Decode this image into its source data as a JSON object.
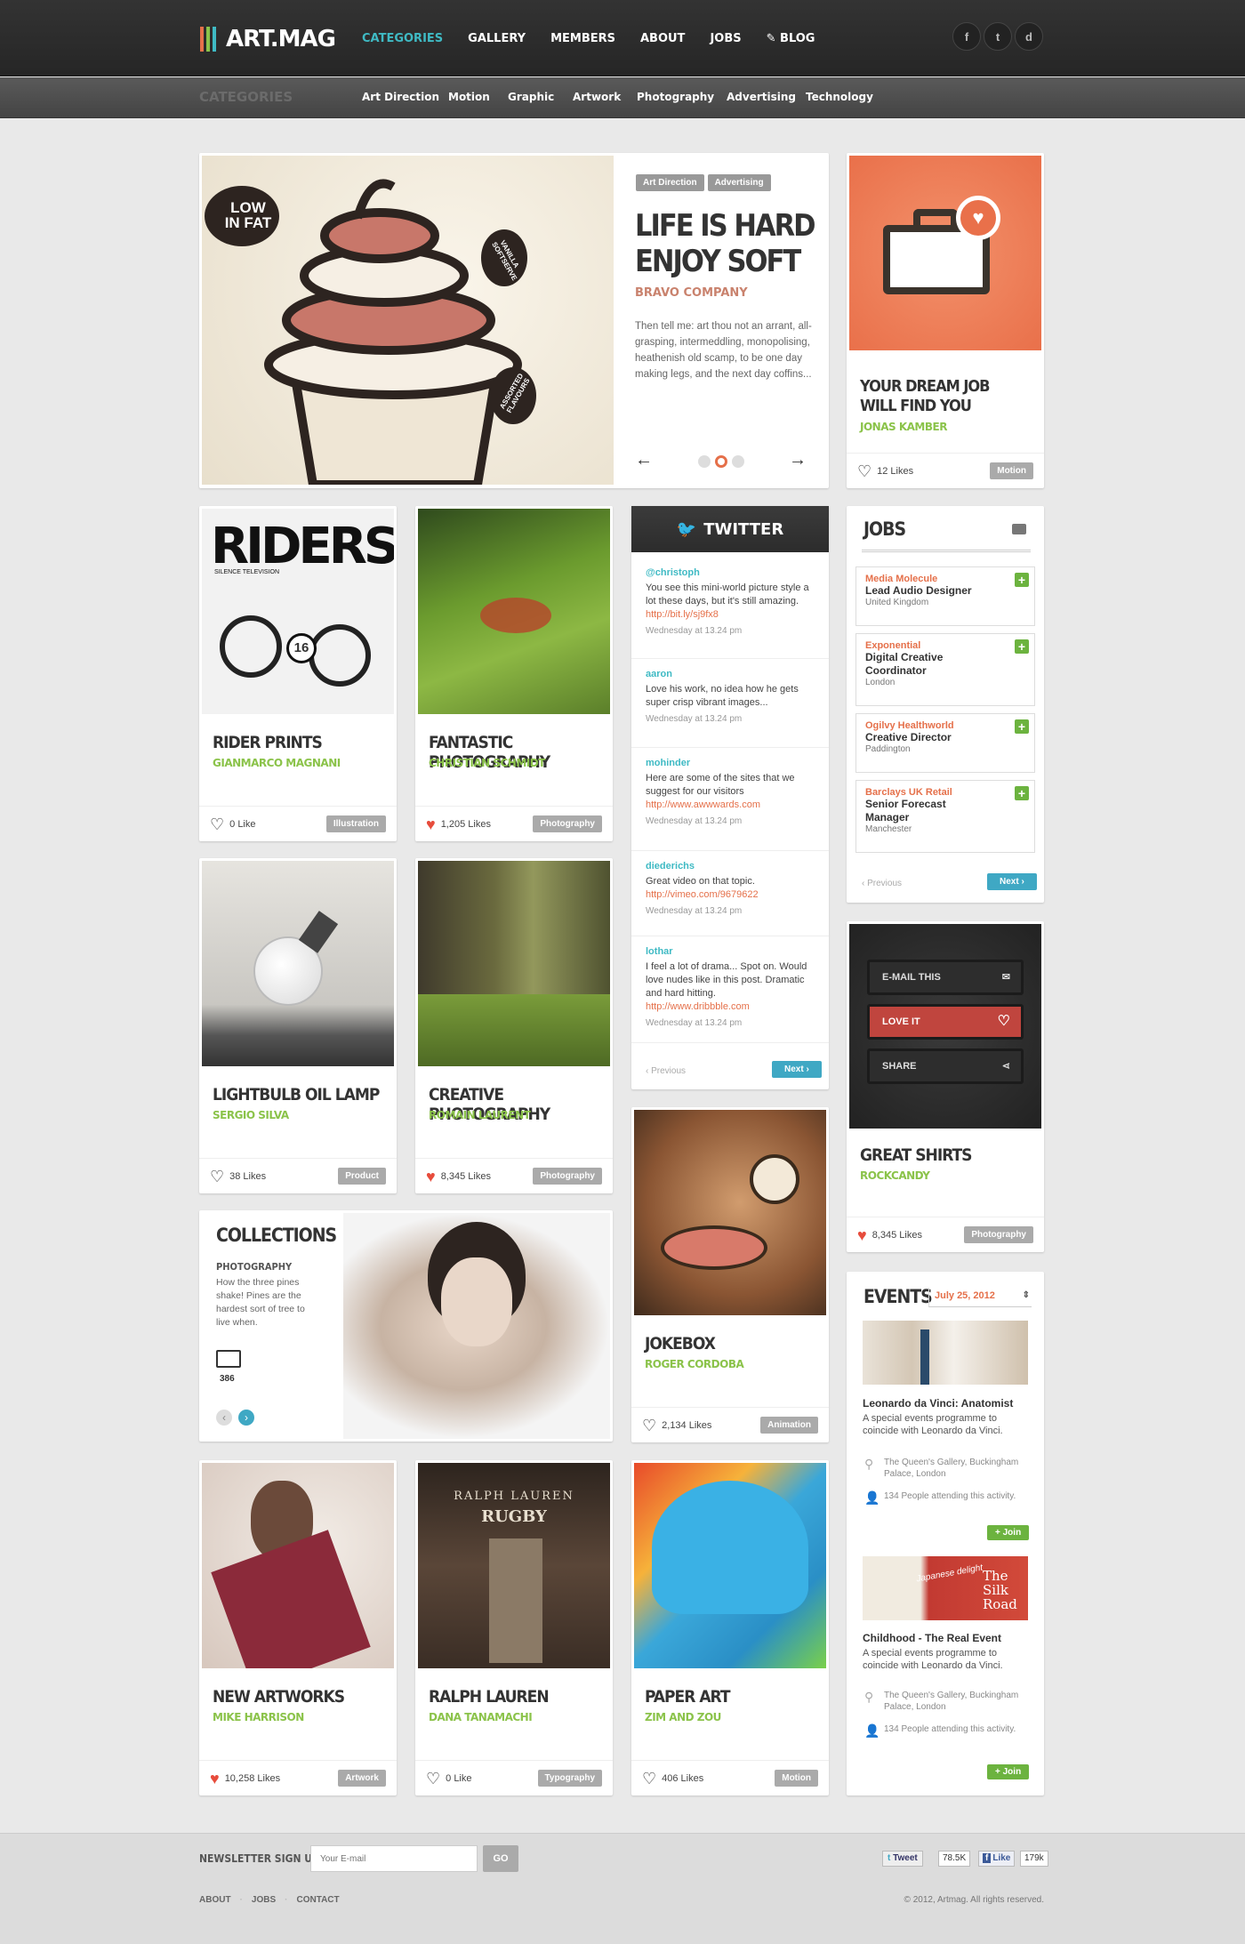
{
  "brand": {
    "name": "ART.MAG",
    "bar_colors": [
      "#e5704a",
      "#8bc34a",
      "#3fbac4"
    ]
  },
  "nav": {
    "items": [
      "CATEGORIES",
      "GALLERY",
      "MEMBERS",
      "ABOUT",
      "JOBS",
      "BLOG"
    ],
    "active": "CATEGORIES"
  },
  "social": {
    "facebook": "f",
    "twitter": "t",
    "dribbble": "d"
  },
  "subnav": {
    "title": "CATEGORIES",
    "items": [
      "Art Direction",
      "Motion",
      "Graphic",
      "Artwork",
      "Photography",
      "Advertising",
      "Technology"
    ]
  },
  "featured": {
    "tags": [
      "Art Direction",
      "Advertising"
    ],
    "title_line1": "LIFE IS HARD",
    "title_line2": "ENJOY SOFT",
    "author": "BRAVO COMPANY",
    "body": "Then tell me: art thou not an arrant, all-grasping, intermeddling, monopolising, heathenish old scamp, to be one day making legs, and the next day coffins...",
    "sticker_low": "LOW IN FAT",
    "sticker_vanilla": "VANILLA SOFTSERVE",
    "sticker_assorted": "ASSORTED FLAVOURS",
    "prev_arrow": "←",
    "next_arrow": "→"
  },
  "job_card": {
    "title": "YOUR DREAM JOB WILL FIND YOU",
    "author": "JONAS KAMBER",
    "likes": "12 Likes",
    "tag": "Motion"
  },
  "cards": [
    {
      "title": "RIDER PRINTS",
      "author": "GIANMARCO MAGNANI",
      "likes": "0 Like",
      "tag": "Illustration",
      "cover_title": "RIDERS",
      "cover_sub": "SILENCE TELEVISION",
      "bike_number": "16"
    },
    {
      "title": "FANTASTIC PHOTOGRAPHY",
      "author": "CHRISTIAN SCHMIDT",
      "likes": "1,205 Likes",
      "tag": "Photography"
    },
    {
      "title": "LIGHTBULB OIL LAMP",
      "author": "SERGIO SILVA",
      "likes": "38 Likes",
      "tag": "Product"
    },
    {
      "title": "CREATIVE PHOTOGRAPHY",
      "author": "ROMAIN LAURENT",
      "likes": "8,345 Likes",
      "tag": "Photography"
    },
    {
      "title": "JOKEBOX",
      "author": "ROGER CORDOBA",
      "likes": "2,134 Likes",
      "tag": "Animation"
    },
    {
      "title": "NEW ARTWORKS",
      "author": "MIKE HARRISON",
      "likes": "10,258 Likes",
      "tag": "Artwork"
    },
    {
      "title": "RALPH LAUREN",
      "author": "DANA TANAMACHI",
      "likes": "0 Like",
      "tag": "Typography",
      "sign_line1": "RALPH LAUREN",
      "sign_line2": "RUGBY"
    },
    {
      "title": "PAPER ART",
      "author": "ZIM AND ZOU",
      "likes": "406 Likes",
      "tag": "Motion"
    }
  ],
  "twitter": {
    "title": "TWITTER",
    "tweets": [
      {
        "user": "@christoph",
        "text": "You see this mini-world picture style a lot these days, but it's still amazing.",
        "link": "http://bit.ly/sj9fx8",
        "time": "Wednesday at 13.24 pm"
      },
      {
        "user": "aaron",
        "text": "Love his work, no idea how he gets super crisp vibrant images...",
        "link": "",
        "time": "Wednesday at 13.24 pm"
      },
      {
        "user": "mohinder",
        "text": "Here are some of the sites that we suggest for our visitors",
        "link": "http://www.awwwards.com",
        "time": "Wednesday at 13.24 pm"
      },
      {
        "user": "diederichs",
        "text": "Great video on that topic.",
        "link": "http://vimeo.com/9679622",
        "time": "Wednesday at 13.24 pm"
      },
      {
        "user": "lothar",
        "text": "I feel a lot of drama... Spot on. Would love nudes like in this post. Dramatic and hard hitting.",
        "link": "http://www.dribbble.com",
        "time": "Wednesday at 13.24 pm"
      }
    ],
    "prev": "‹  Previous",
    "next": "Next  ›"
  },
  "jobs": {
    "title": "JOBS",
    "items": [
      {
        "company": "Media Molecule",
        "role": "Lead Audio Designer",
        "location": "United Kingdom"
      },
      {
        "company": "Exponential",
        "role": "Digital Creative Coordinator",
        "location": "London"
      },
      {
        "company": "Ogilvy Healthworld",
        "role": "Creative Director",
        "location": "Paddington"
      },
      {
        "company": "Barclays UK Retail",
        "role": "Senior Forecast Manager",
        "location": "Manchester"
      }
    ],
    "prev": "‹  Previous",
    "next": "Next  ›"
  },
  "shirts": {
    "actions": [
      "E-MAIL THIS",
      "LOVE IT",
      "SHARE"
    ],
    "title": "GREAT SHIRTS",
    "author": "ROCKCANDY",
    "likes": "8,345 Likes",
    "tag": "Photography"
  },
  "collections": {
    "title": "COLLECTIONS",
    "subtitle": "PHOTOGRAPHY",
    "body": "How the three pines shake! Pines are the hardest sort of tree to live when.",
    "count": "386"
  },
  "events": {
    "title": "EVENTS",
    "date": "July 25, 2012",
    "items": [
      {
        "title": "Leonardo da Vinci: Anatomist",
        "desc": "A special events programme to coincide with Leonardo da Vinci.",
        "place": "The Queen's Gallery, Buckingham Palace, London",
        "attending": "134 People attending this activity.",
        "join": "+ Join"
      },
      {
        "title": "Childhood - The Real Event",
        "desc": "A special events programme to coincide with Leonardo da Vinci.",
        "place": "The Queen's Gallery, Buckingham Palace, London",
        "attending": "134 People attending this activity.",
        "join": "+ Join",
        "image_line1": "Japanese delight",
        "image_line2": "The Silk Road"
      }
    ]
  },
  "footer": {
    "newsletter": "NEWSLETTER SIGN UP",
    "email_placeholder": "Your E-mail",
    "go": "GO",
    "tweet": "Tweet",
    "tweet_count": "78.5K",
    "like": "Like",
    "like_count": "179k",
    "links": [
      "ABOUT",
      "JOBS",
      "CONTACT"
    ],
    "copyright": "© 2012, Artmag. All rights reserved."
  }
}
